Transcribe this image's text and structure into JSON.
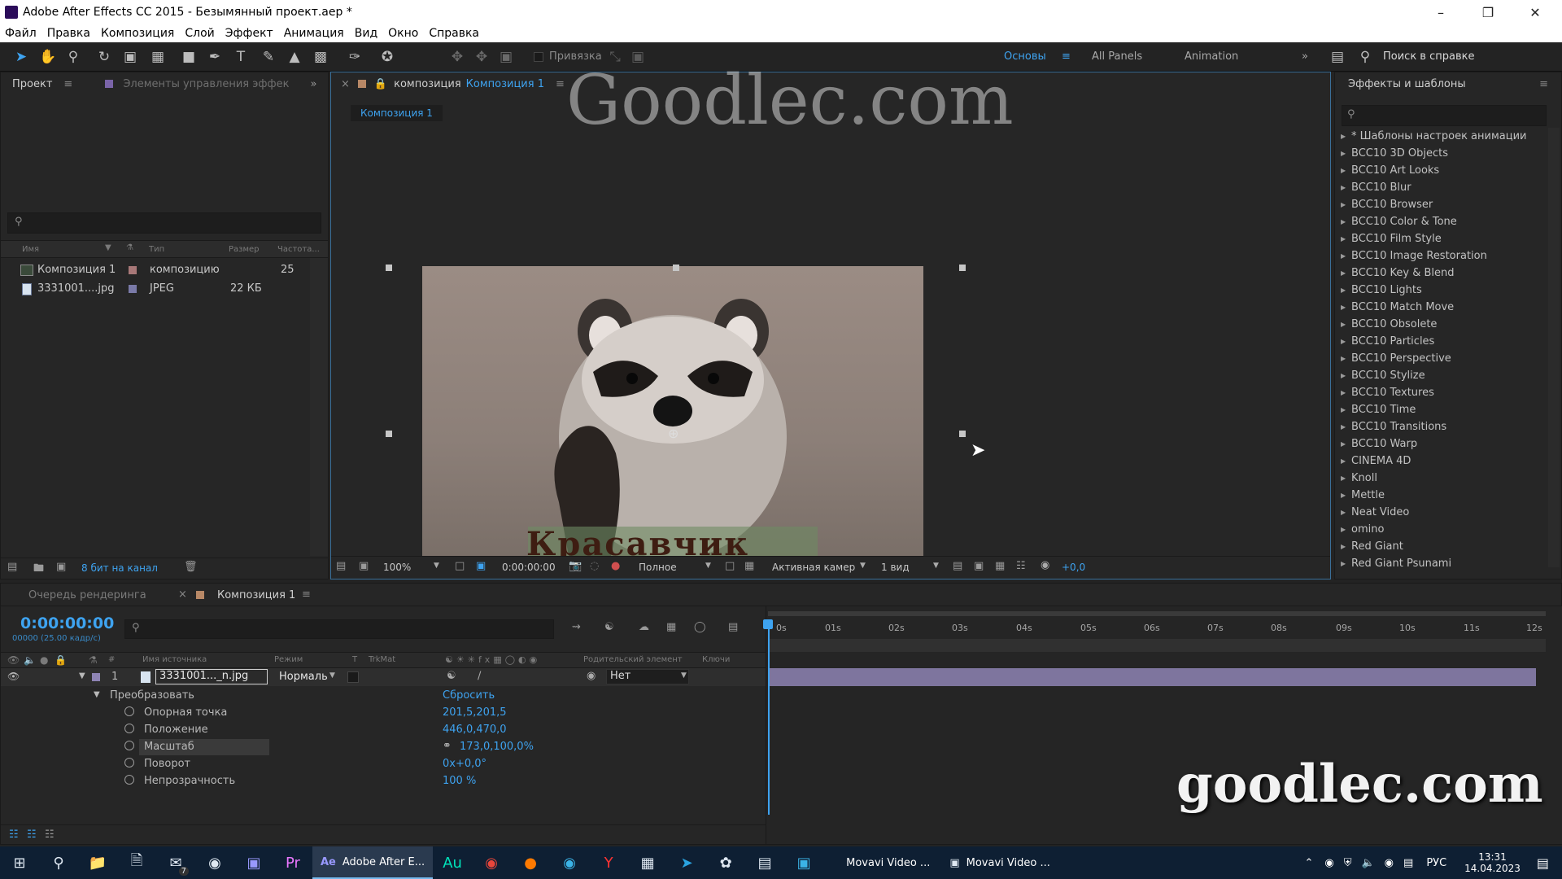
{
  "window": {
    "title": "Adobe After Effects CC 2015 - Безымянный проект.aep *"
  },
  "menu": [
    "Файл",
    "Правка",
    "Композиция",
    "Слой",
    "Эффект",
    "Анимация",
    "Вид",
    "Окно",
    "Справка"
  ],
  "toolbar": {
    "snap_label": "Привязка",
    "workspaces": [
      "Основы",
      "All Panels",
      "Animation"
    ],
    "help_search_placeholder": "Поиск в справке"
  },
  "project_panel": {
    "tab_project": "Проект",
    "tab_effect_controls": "Элементы управления эффек",
    "columns": {
      "name": "Имя",
      "type": "Тип",
      "size": "Размер",
      "fps": "Частота..."
    },
    "items": [
      {
        "name": "Композиция 1",
        "type": "композицию",
        "size": "",
        "fps": "25"
      },
      {
        "name": "3331001....jpg",
        "type": "JPEG",
        "size": "22 КБ",
        "fps": ""
      }
    ],
    "bpc": "8 бит на канал"
  },
  "comp_panel": {
    "tab_prefix": "композиция",
    "tab_name": "Композиция 1",
    "breadcrumb": "Композиция 1",
    "zoom": "100%",
    "time": "0:00:00:00",
    "resolution": "Полное",
    "camera": "Активная камер",
    "views": "1 вид",
    "exposure": "+0,0",
    "image_caption": "Красавчик"
  },
  "effects_panel": {
    "title": "Эффекты и шаблоны",
    "items": [
      "* Шаблоны настроек анимации",
      "BCC10 3D Objects",
      "BCC10 Art Looks",
      "BCC10 Blur",
      "BCC10 Browser",
      "BCC10 Color & Tone",
      "BCC10 Film Style",
      "BCC10 Image Restoration",
      "BCC10 Key & Blend",
      "BCC10 Lights",
      "BCC10 Match Move",
      "BCC10 Obsolete",
      "BCC10 Particles",
      "BCC10 Perspective",
      "BCC10 Stylize",
      "BCC10 Textures",
      "BCC10 Time",
      "BCC10 Transitions",
      "BCC10 Warp",
      "CINEMA 4D",
      "Knoll",
      "Mettle",
      "Neat Video",
      "omino",
      "Red Giant",
      "Red Giant Psunami"
    ]
  },
  "timeline": {
    "tab_render_queue": "Очередь рендеринга",
    "tab_comp": "Композиция 1",
    "timecode": "0:00:00:00",
    "frame_info": "00000 (25.00 кадр/с)",
    "col_source": "Имя источника",
    "col_mode": "Режим",
    "col_t": "T",
    "col_trkmat": "TrkMat",
    "col_parent": "Родительский элемент",
    "col_keys": "Ключи",
    "layer": {
      "index": "1",
      "name": "3331001..._n.jpg",
      "mode": "Нормаль",
      "parent": "Нет"
    },
    "transform_label": "Преобразовать",
    "reset_label": "Сбросить",
    "properties": [
      {
        "name": "Опорная точка",
        "value": "201,5,201,5"
      },
      {
        "name": "Положение",
        "value": "446,0,470,0"
      },
      {
        "name": "Масштаб",
        "value": "173,0,100,0%"
      },
      {
        "name": "Поворот",
        "value": "0x+0,0°"
      },
      {
        "name": "Непрозрачность",
        "value": "100 %"
      }
    ],
    "ruler": [
      "0s",
      "01s",
      "02s",
      "03s",
      "04s",
      "05s",
      "06s",
      "07s",
      "08s",
      "09s",
      "10s",
      "11s",
      "12s"
    ]
  },
  "watermarks": {
    "top": "Goodlec.com",
    "bottom": "goodlec.com"
  },
  "taskbar": {
    "ae_label": "Adobe After E...",
    "movavi1": "Movavi Video ...",
    "movavi2": "Movavi Video ...",
    "lang": "РУС",
    "time": "13:31",
    "date": "14.04.2023",
    "mail_badge": "7"
  },
  "colors": {
    "accent_blue": "#3ea3f0",
    "layer_bar": "#8e84b4",
    "taskbar": "#0e1f33"
  }
}
